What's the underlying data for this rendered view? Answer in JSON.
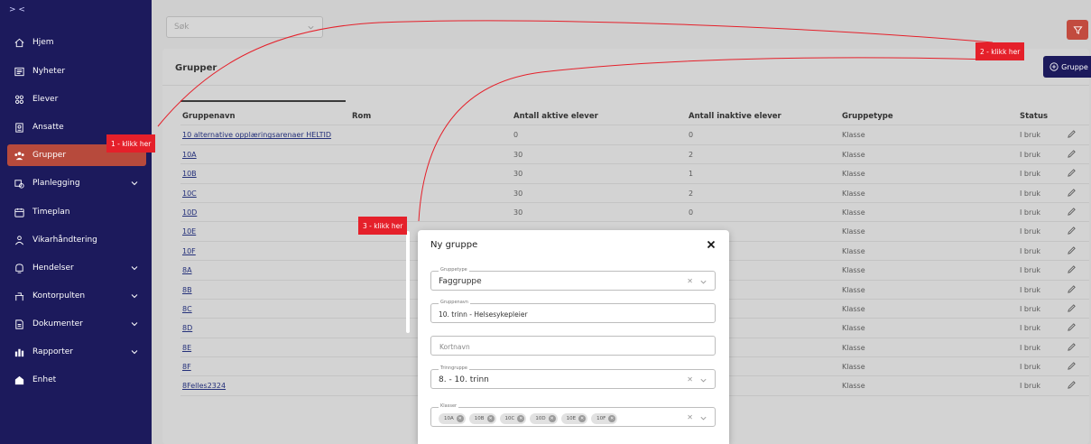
{
  "sidebar": {
    "toggle": "> <",
    "items": [
      {
        "label": "Hjem",
        "icon": "home-icon",
        "expandable": false
      },
      {
        "label": "Nyheter",
        "icon": "news-icon",
        "expandable": false
      },
      {
        "label": "Elever",
        "icon": "students-icon",
        "expandable": false
      },
      {
        "label": "Ansatte",
        "icon": "employee-badge-icon",
        "expandable": false
      },
      {
        "label": "Grupper",
        "icon": "groups-icon",
        "expandable": false,
        "active": true
      },
      {
        "label": "Planlegging",
        "icon": "planning-icon",
        "expandable": true
      },
      {
        "label": "Timeplan",
        "icon": "schedule-icon",
        "expandable": false
      },
      {
        "label": "Vikarhåndtering",
        "icon": "substitute-icon",
        "expandable": false
      },
      {
        "label": "Hendelser",
        "icon": "events-icon",
        "expandable": true
      },
      {
        "label": "Kontorpulten",
        "icon": "office-desk-icon",
        "expandable": true
      },
      {
        "label": "Dokumenter",
        "icon": "documents-icon",
        "expandable": true
      },
      {
        "label": "Rapporter",
        "icon": "reports-icon",
        "expandable": true
      },
      {
        "label": "Enhet",
        "icon": "unit-icon",
        "expandable": false
      }
    ]
  },
  "search": {
    "placeholder": "Søk"
  },
  "page": {
    "title": "Grupper",
    "add_button": "Gruppe"
  },
  "table": {
    "headers": [
      "Gruppenavn",
      "Rom",
      "Antall aktive elever",
      "Antall inaktive elever",
      "Gruppetype",
      "Status"
    ],
    "rows": [
      {
        "name": "10 alternative opplæringsarenaer HELTID",
        "rom": "",
        "active": "0",
        "inactive": "0",
        "type": "Klasse",
        "status": "I bruk"
      },
      {
        "name": "10A",
        "rom": "",
        "active": "30",
        "inactive": "2",
        "type": "Klasse",
        "status": "I bruk"
      },
      {
        "name": "10B",
        "rom": "",
        "active": "30",
        "inactive": "1",
        "type": "Klasse",
        "status": "I bruk"
      },
      {
        "name": "10C",
        "rom": "",
        "active": "30",
        "inactive": "2",
        "type": "Klasse",
        "status": "I bruk"
      },
      {
        "name": "10D",
        "rom": "",
        "active": "30",
        "inactive": "0",
        "type": "Klasse",
        "status": "I bruk"
      },
      {
        "name": "10E",
        "rom": "",
        "active": "",
        "inactive": "",
        "type": "Klasse",
        "status": "I bruk"
      },
      {
        "name": "10F",
        "rom": "",
        "active": "",
        "inactive": "",
        "type": "Klasse",
        "status": "I bruk"
      },
      {
        "name": "8A",
        "rom": "",
        "active": "",
        "inactive": "",
        "type": "Klasse",
        "status": "I bruk"
      },
      {
        "name": "8B",
        "rom": "",
        "active": "",
        "inactive": "",
        "type": "Klasse",
        "status": "I bruk"
      },
      {
        "name": "8C",
        "rom": "",
        "active": "",
        "inactive": "",
        "type": "Klasse",
        "status": "I bruk"
      },
      {
        "name": "8D",
        "rom": "",
        "active": "",
        "inactive": "",
        "type": "Klasse",
        "status": "I bruk"
      },
      {
        "name": "8E",
        "rom": "",
        "active": "",
        "inactive": "",
        "type": "Klasse",
        "status": "I bruk"
      },
      {
        "name": "8F",
        "rom": "",
        "active": "",
        "inactive": "",
        "type": "Klasse",
        "status": "I bruk"
      },
      {
        "name": "8Felles2324",
        "rom": "",
        "active": "",
        "inactive": "",
        "type": "Klasse",
        "status": "I bruk"
      }
    ]
  },
  "modal": {
    "title": "Ny gruppe",
    "fields": {
      "gruppetype": {
        "label": "Gruppetype",
        "value": "Faggruppe"
      },
      "gruppenavn": {
        "label": "Gruppenavn",
        "value": "10. trinn - Helsesykepleier"
      },
      "kortnavn": {
        "placeholder": "Kortnavn"
      },
      "trinngruppe": {
        "label": "Trinngruppe",
        "value": "8. - 10. trinn"
      },
      "klasser": {
        "label": "Klasser",
        "chips": [
          "10A",
          "10B",
          "10C",
          "10D",
          "10E",
          "10F"
        ]
      }
    }
  },
  "callouts": {
    "one": "1 - klikk her",
    "two": "2 - klikk her",
    "three": "3 - klikk her"
  },
  "colors": {
    "sidebar": "#1c1a5c",
    "active": "#b74a3c",
    "callout": "#e5202a",
    "primary": "#1c1a5c",
    "filter": "#c24b3f"
  }
}
